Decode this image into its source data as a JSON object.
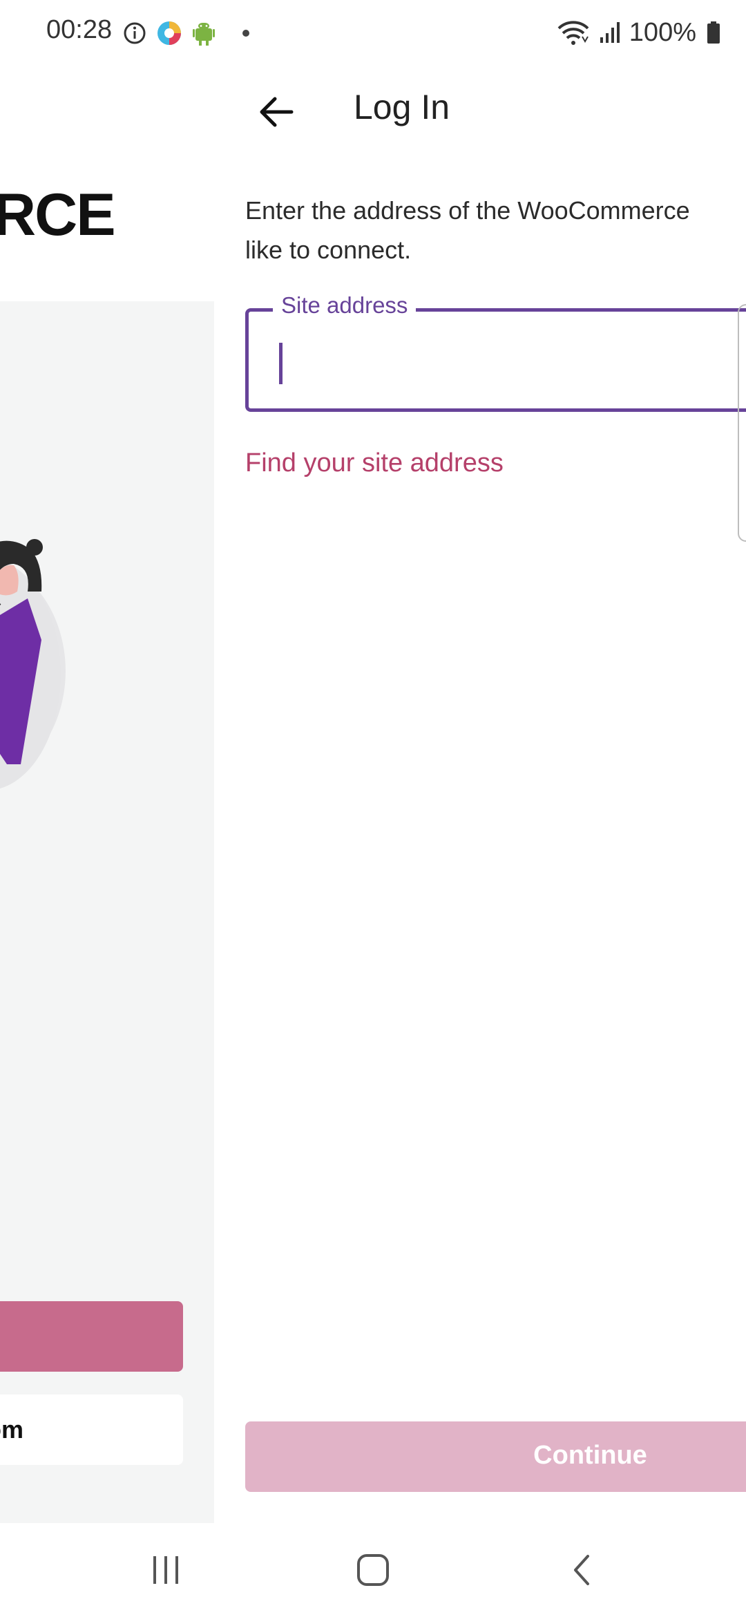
{
  "status_bar": {
    "time": "00:28",
    "battery": "100%",
    "icons": [
      "info-icon",
      "app-color-icon",
      "android-debug-icon",
      "notification-dot-icon",
      "wifi-icon",
      "cellular-signal-icon",
      "battery-icon"
    ]
  },
  "background": {
    "logo_fragment": "RCE",
    "secondary_button_label_fragment": "om",
    "accent": "#c76b8c"
  },
  "header": {
    "back_icon": "arrow-left-icon",
    "title": "Log In"
  },
  "main": {
    "instructions": "Enter the address of the WooCommerce",
    "instructions_line2": "like to connect.",
    "site_field": {
      "label": "Site address",
      "value": ""
    },
    "help_link": "Find your site address",
    "continue_label": "Continue"
  },
  "nav_bar": {
    "items": [
      "recent-apps-icon",
      "home-icon",
      "back-icon"
    ]
  },
  "colors": {
    "primary": "#674399",
    "link": "#b5406a",
    "continue_disabled": "#e1b3c7"
  }
}
